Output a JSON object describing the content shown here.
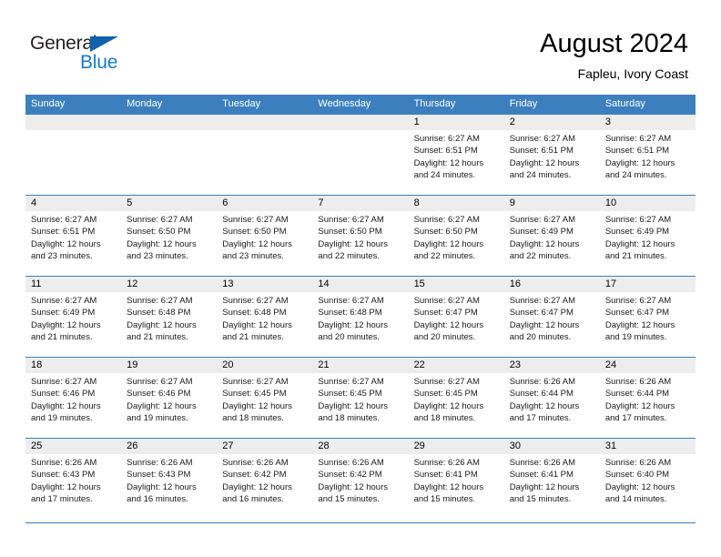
{
  "brand": {
    "name_part1": "General",
    "name_part2": "Blue",
    "triangle_icon": "triangle-icon",
    "colors": {
      "dark": "#231f20",
      "blue": "#1779d0",
      "triangle": "#1161ad"
    }
  },
  "header": {
    "title": "August 2024",
    "subtitle": "Fapleu, Ivory Coast"
  },
  "colors": {
    "header_row_bg": "#3c7fbf",
    "header_row_text": "#ffffff",
    "daynum_band_bg": "#ededed",
    "cell_bg": "#ffffff",
    "grid_line": "#3c7fbf"
  },
  "weekdays": [
    "Sunday",
    "Monday",
    "Tuesday",
    "Wednesday",
    "Thursday",
    "Friday",
    "Saturday"
  ],
  "weeks": [
    [
      {
        "day": "",
        "sunrise": "",
        "sunset": "",
        "daylight": ""
      },
      {
        "day": "",
        "sunrise": "",
        "sunset": "",
        "daylight": ""
      },
      {
        "day": "",
        "sunrise": "",
        "sunset": "",
        "daylight": ""
      },
      {
        "day": "",
        "sunrise": "",
        "sunset": "",
        "daylight": ""
      },
      {
        "day": "1",
        "sunrise": "Sunrise: 6:27 AM",
        "sunset": "Sunset: 6:51 PM",
        "daylight": "Daylight: 12 hours and 24 minutes."
      },
      {
        "day": "2",
        "sunrise": "Sunrise: 6:27 AM",
        "sunset": "Sunset: 6:51 PM",
        "daylight": "Daylight: 12 hours and 24 minutes."
      },
      {
        "day": "3",
        "sunrise": "Sunrise: 6:27 AM",
        "sunset": "Sunset: 6:51 PM",
        "daylight": "Daylight: 12 hours and 24 minutes."
      }
    ],
    [
      {
        "day": "4",
        "sunrise": "Sunrise: 6:27 AM",
        "sunset": "Sunset: 6:51 PM",
        "daylight": "Daylight: 12 hours and 23 minutes."
      },
      {
        "day": "5",
        "sunrise": "Sunrise: 6:27 AM",
        "sunset": "Sunset: 6:50 PM",
        "daylight": "Daylight: 12 hours and 23 minutes."
      },
      {
        "day": "6",
        "sunrise": "Sunrise: 6:27 AM",
        "sunset": "Sunset: 6:50 PM",
        "daylight": "Daylight: 12 hours and 23 minutes."
      },
      {
        "day": "7",
        "sunrise": "Sunrise: 6:27 AM",
        "sunset": "Sunset: 6:50 PM",
        "daylight": "Daylight: 12 hours and 22 minutes."
      },
      {
        "day": "8",
        "sunrise": "Sunrise: 6:27 AM",
        "sunset": "Sunset: 6:50 PM",
        "daylight": "Daylight: 12 hours and 22 minutes."
      },
      {
        "day": "9",
        "sunrise": "Sunrise: 6:27 AM",
        "sunset": "Sunset: 6:49 PM",
        "daylight": "Daylight: 12 hours and 22 minutes."
      },
      {
        "day": "10",
        "sunrise": "Sunrise: 6:27 AM",
        "sunset": "Sunset: 6:49 PM",
        "daylight": "Daylight: 12 hours and 21 minutes."
      }
    ],
    [
      {
        "day": "11",
        "sunrise": "Sunrise: 6:27 AM",
        "sunset": "Sunset: 6:49 PM",
        "daylight": "Daylight: 12 hours and 21 minutes."
      },
      {
        "day": "12",
        "sunrise": "Sunrise: 6:27 AM",
        "sunset": "Sunset: 6:48 PM",
        "daylight": "Daylight: 12 hours and 21 minutes."
      },
      {
        "day": "13",
        "sunrise": "Sunrise: 6:27 AM",
        "sunset": "Sunset: 6:48 PM",
        "daylight": "Daylight: 12 hours and 21 minutes."
      },
      {
        "day": "14",
        "sunrise": "Sunrise: 6:27 AM",
        "sunset": "Sunset: 6:48 PM",
        "daylight": "Daylight: 12 hours and 20 minutes."
      },
      {
        "day": "15",
        "sunrise": "Sunrise: 6:27 AM",
        "sunset": "Sunset: 6:47 PM",
        "daylight": "Daylight: 12 hours and 20 minutes."
      },
      {
        "day": "16",
        "sunrise": "Sunrise: 6:27 AM",
        "sunset": "Sunset: 6:47 PM",
        "daylight": "Daylight: 12 hours and 20 minutes."
      },
      {
        "day": "17",
        "sunrise": "Sunrise: 6:27 AM",
        "sunset": "Sunset: 6:47 PM",
        "daylight": "Daylight: 12 hours and 19 minutes."
      }
    ],
    [
      {
        "day": "18",
        "sunrise": "Sunrise: 6:27 AM",
        "sunset": "Sunset: 6:46 PM",
        "daylight": "Daylight: 12 hours and 19 minutes."
      },
      {
        "day": "19",
        "sunrise": "Sunrise: 6:27 AM",
        "sunset": "Sunset: 6:46 PM",
        "daylight": "Daylight: 12 hours and 19 minutes."
      },
      {
        "day": "20",
        "sunrise": "Sunrise: 6:27 AM",
        "sunset": "Sunset: 6:45 PM",
        "daylight": "Daylight: 12 hours and 18 minutes."
      },
      {
        "day": "21",
        "sunrise": "Sunrise: 6:27 AM",
        "sunset": "Sunset: 6:45 PM",
        "daylight": "Daylight: 12 hours and 18 minutes."
      },
      {
        "day": "22",
        "sunrise": "Sunrise: 6:27 AM",
        "sunset": "Sunset: 6:45 PM",
        "daylight": "Daylight: 12 hours and 18 minutes."
      },
      {
        "day": "23",
        "sunrise": "Sunrise: 6:26 AM",
        "sunset": "Sunset: 6:44 PM",
        "daylight": "Daylight: 12 hours and 17 minutes."
      },
      {
        "day": "24",
        "sunrise": "Sunrise: 6:26 AM",
        "sunset": "Sunset: 6:44 PM",
        "daylight": "Daylight: 12 hours and 17 minutes."
      }
    ],
    [
      {
        "day": "25",
        "sunrise": "Sunrise: 6:26 AM",
        "sunset": "Sunset: 6:43 PM",
        "daylight": "Daylight: 12 hours and 17 minutes."
      },
      {
        "day": "26",
        "sunrise": "Sunrise: 6:26 AM",
        "sunset": "Sunset: 6:43 PM",
        "daylight": "Daylight: 12 hours and 16 minutes."
      },
      {
        "day": "27",
        "sunrise": "Sunrise: 6:26 AM",
        "sunset": "Sunset: 6:42 PM",
        "daylight": "Daylight: 12 hours and 16 minutes."
      },
      {
        "day": "28",
        "sunrise": "Sunrise: 6:26 AM",
        "sunset": "Sunset: 6:42 PM",
        "daylight": "Daylight: 12 hours and 15 minutes."
      },
      {
        "day": "29",
        "sunrise": "Sunrise: 6:26 AM",
        "sunset": "Sunset: 6:41 PM",
        "daylight": "Daylight: 12 hours and 15 minutes."
      },
      {
        "day": "30",
        "sunrise": "Sunrise: 6:26 AM",
        "sunset": "Sunset: 6:41 PM",
        "daylight": "Daylight: 12 hours and 15 minutes."
      },
      {
        "day": "31",
        "sunrise": "Sunrise: 6:26 AM",
        "sunset": "Sunset: 6:40 PM",
        "daylight": "Daylight: 12 hours and 14 minutes."
      }
    ]
  ]
}
